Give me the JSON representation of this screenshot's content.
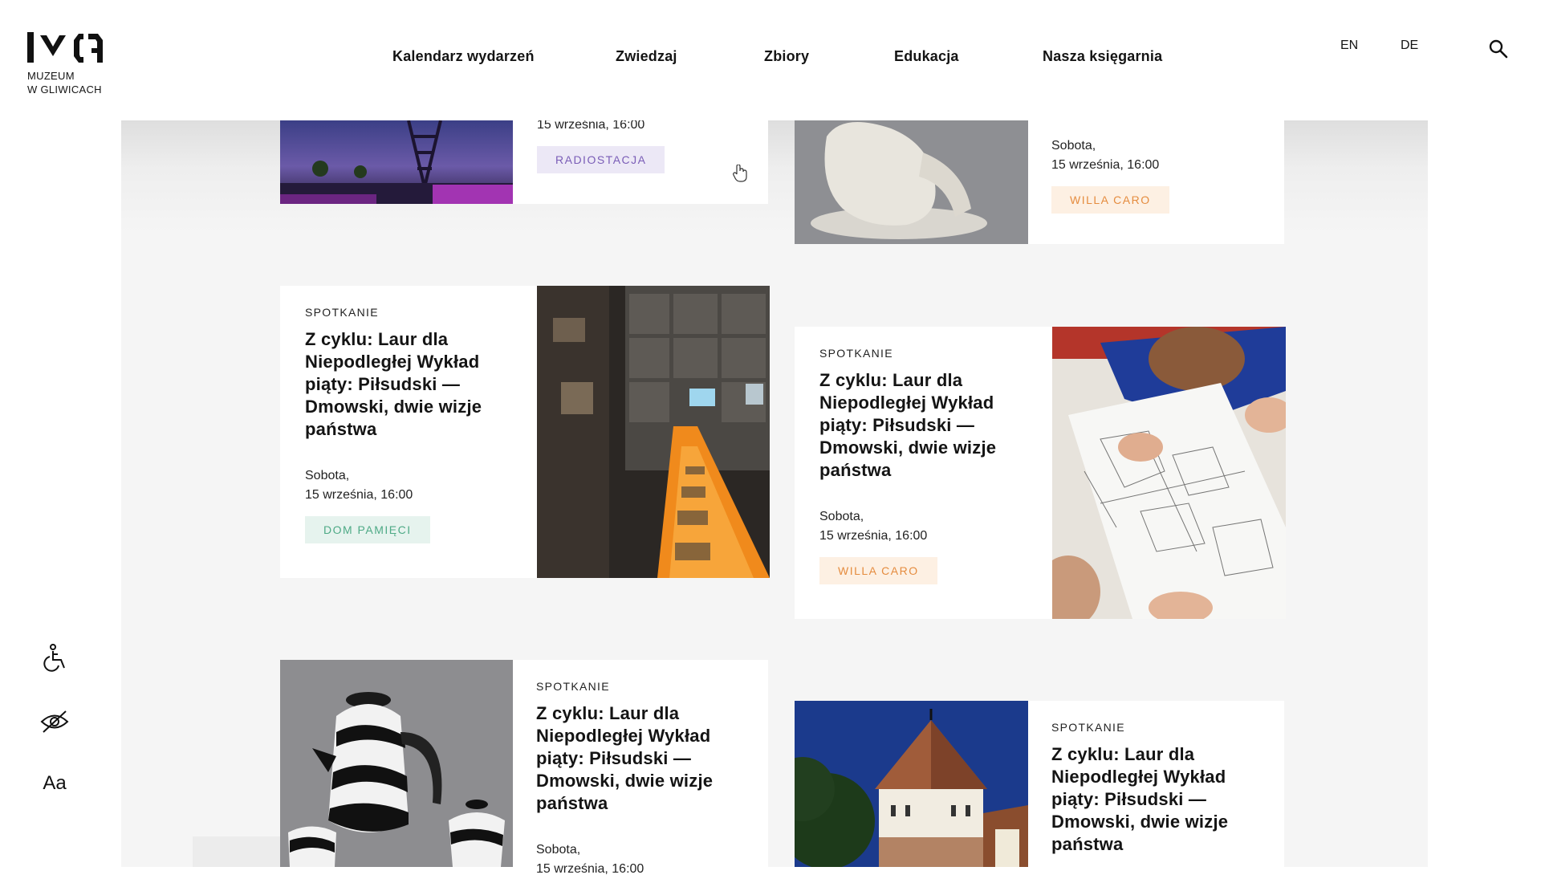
{
  "header": {
    "logo_text_line1": "MUZEUM",
    "logo_text_line2": "W GLIWICACH",
    "nav": [
      {
        "label": "Kalendarz wydarzeń"
      },
      {
        "label": "Zwiedzaj"
      },
      {
        "label": "Zbiory"
      },
      {
        "label": "Edukacja"
      },
      {
        "label": "Nasza księgarnia"
      }
    ],
    "languages": [
      "EN",
      "DE"
    ],
    "search_icon": "search-icon"
  },
  "accessibility": {
    "items": [
      {
        "icon": "wheelchair-icon"
      },
      {
        "icon": "eye-slash-icon"
      },
      {
        "label": "Aa"
      }
    ]
  },
  "cards": [
    {
      "id": "top-left",
      "date_partial": "15 września, 16:00",
      "tag": "RADIOSTACJA",
      "tag_color": "#7a5db7",
      "image": "radio-tower-night-photo"
    },
    {
      "id": "top-right",
      "date_line1": "Sobota,",
      "date_line2": "15 września, 16:00",
      "tag": "WILLA CARO",
      "tag_color": "#e58c3f",
      "image": "white-sculpture-photo"
    },
    {
      "id": "mid-left",
      "category": "SPOTKANIE",
      "title": "Z cyklu: Laur dla Niepodległej Wykład piąty: Piłsudski — Dmowski, dwie wizje państwa",
      "date_line1": "Sobota,",
      "date_line2": "15 września, 16:00",
      "tag": "DOM PAMIĘCI",
      "tag_color": "#4eaa86",
      "image": "museum-exhibition-photo"
    },
    {
      "id": "mid-right",
      "category": "SPOTKANIE",
      "title": "Z cyklu: Laur dla Niepodległej Wykład piąty: Piłsudski — Dmowski, dwie wizje państwa",
      "date_line1": "Sobota,",
      "date_line2": "15 września, 16:00",
      "tag": "WILLA CARO",
      "tag_color": "#e58c3f",
      "image": "child-drawing-photo"
    },
    {
      "id": "bottom-left",
      "category": "SPOTKANIE",
      "title": "Z cyklu: Laur dla Niepodległej Wykład piąty: Piłsudski — Dmowski, dwie wizje państwa",
      "date_line1": "Sobota,",
      "date_line2": "15 września, 16:00",
      "image": "zebra-teapot-photo"
    },
    {
      "id": "bottom-right",
      "category": "SPOTKANIE",
      "title": "Z cyklu: Laur dla Niepodległej Wykład piąty: Piłsudski — Dmowski, dwie wizje państwa",
      "image": "castle-tower-night-photo"
    }
  ]
}
